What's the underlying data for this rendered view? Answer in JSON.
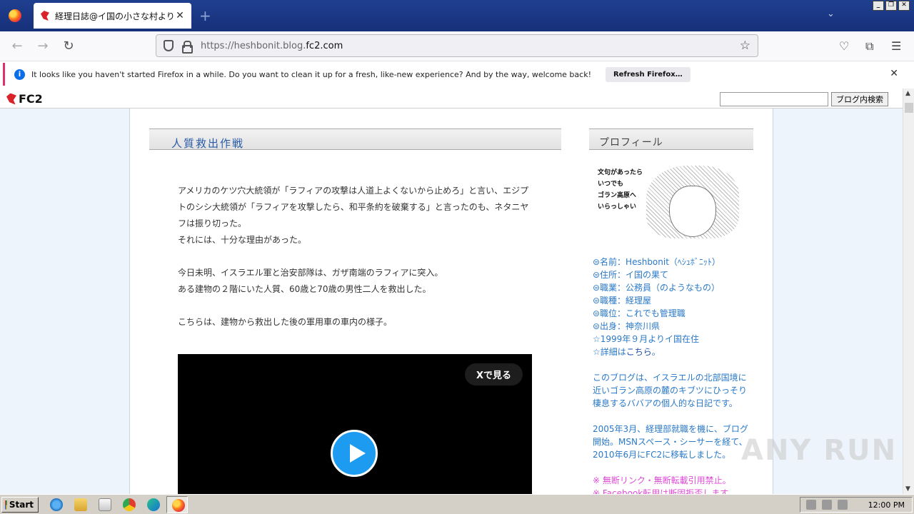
{
  "browser": {
    "tab_title": "経理日誌@イ国の小さな村より",
    "url_prefix": "https://heshbonit.blog.",
    "url_domain": "fc2.com",
    "notification_text": "It looks like you haven't started Firefox in a while. Do you want to clean it up for a fresh, like-new experience? And by the way, welcome back!",
    "notification_button": "Refresh Firefox…"
  },
  "fc2": {
    "logo_text": "FC2",
    "search_button": "ブログ内検索",
    "search_value": ""
  },
  "entry": {
    "title": "人質救出作戦",
    "paragraphs": [
      "アメリカのケツ穴大統領が「ラフィアの攻撃は人道上よくないから止めろ」と言い、エジプ",
      "トのシシ大統領が「ラフィアを攻撃したら、和平条約を破棄する」と言ったのも、ネタニヤ",
      "フは振り切った。",
      "それには、十分な理由があった。",
      "",
      "今日未明、イスラエル軍と治安部隊は、ガザ南端のラフィアに突入。",
      "ある建物の２階にいた人質、60歳と70歳の男性二人を救出した。",
      "",
      "こちらは、建物から救出した後の軍用車の車内の様子。"
    ],
    "video_button": "Xで見る"
  },
  "sidebar": {
    "title": "プロフィール",
    "image_caption_lines": [
      "文句があったら",
      "いつでも",
      "ゴラン高原へ",
      "いらっしゃい"
    ],
    "profile_items": [
      "⊜名前：Heshbonit（ﾍｼｭﾎﾞﾆｯﾄ）",
      "⊜住所：イ国の果て",
      "⊜職業：公務員（のようなもの）",
      "⊜職種：経理屋",
      "⊜職位：これでも管理職",
      "⊜出身：神奈川県",
      "☆1999年９月よりイ国在住"
    ],
    "detail_prefix": "☆詳細は",
    "detail_link": "こちら",
    "detail_suffix": "。",
    "description_1": "このブログは、イスラエルの北部国境に近いゴラン高原の麓のキブツにひっそり棲息するババアの個人的な日記です。",
    "description_2": "2005年3月、経理部就職を機に、ブログ開始。MSNスペース・シーサーを経て、2010年6月にFC2に移転しました。",
    "notes": [
      "※ 無断リンク・無断転載引用禁止。",
      "※ Facebook転用は断固拒否します"
    ]
  },
  "watermark": "ANY RUN",
  "taskbar": {
    "start_label": "Start",
    "clock": "12:00 PM"
  }
}
